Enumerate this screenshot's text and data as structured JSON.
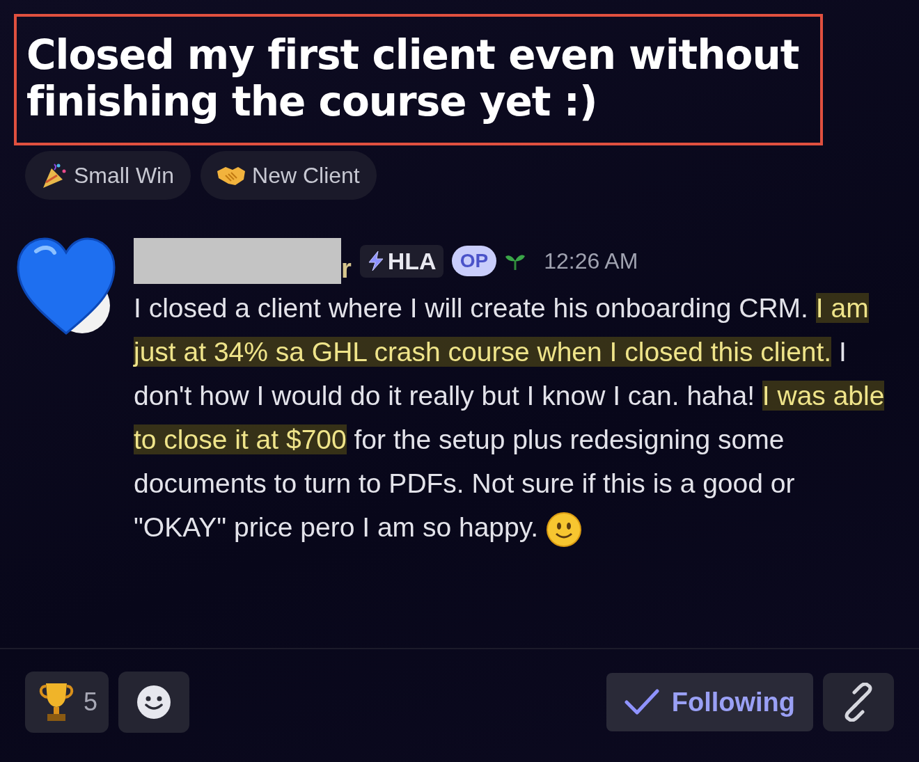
{
  "post": {
    "title": "Closed my first client even without finishing the course yet :)",
    "title_outlined": true
  },
  "tags": [
    {
      "label": "Small Win",
      "kind": "party"
    },
    {
      "label": "New Client",
      "kind": "handshake"
    }
  ],
  "message": {
    "author": "r",
    "author_redacted": true,
    "role_badge": "HLA",
    "op_badge": "OP",
    "time": "12:26 AM",
    "segments": [
      {
        "text": "I closed a client where I will create his onboarding CRM. ",
        "highlighted": false
      },
      {
        "text": "I am just at 34% sa GHL crash course when I closed this client.",
        "highlighted": true
      },
      {
        "text": " I don't how I would do it really but I know I can. haha! ",
        "highlighted": false
      },
      {
        "text": "I was able to close it at $700",
        "highlighted": true
      },
      {
        "text": " for the setup plus redesigning some documents to turn to PDFs. Not sure if this is a good or \"OKAY\" price pero I am so happy.",
        "highlighted": false
      }
    ]
  },
  "reactions": [
    {
      "count": "5"
    }
  ],
  "follow_button": {
    "label": "Following",
    "selected": true
  }
}
